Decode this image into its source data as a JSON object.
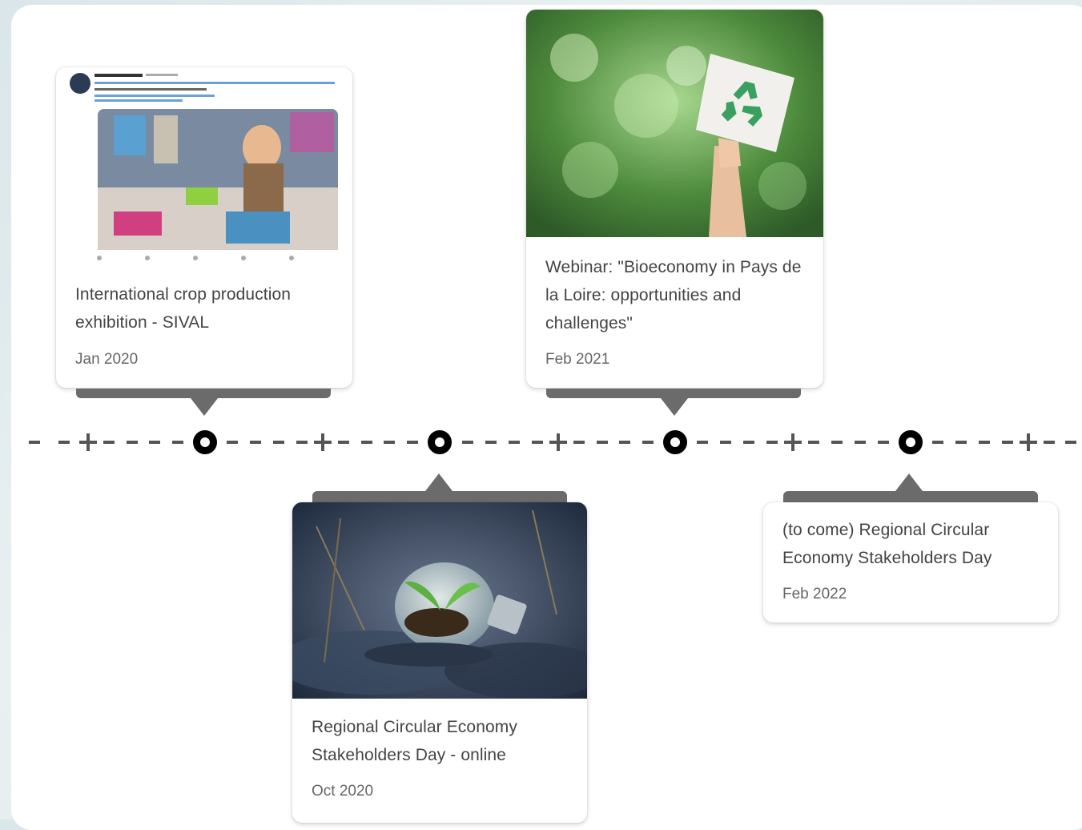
{
  "timeline": {
    "events": [
      {
        "title": "International crop production exhibition - SIVAL",
        "date": "Jan 2020"
      },
      {
        "title": "Regional Circular Economy Stakeholders Day - online",
        "date": "Oct 2020"
      },
      {
        "title": "Webinar: \"Bioeconomy in Pays de la Loire: opportunities and challenges\"",
        "date": "Feb 2021"
      },
      {
        "title": "(to come) Regional Circular Economy Stakeholders Day",
        "date": "Feb 2022"
      }
    ]
  },
  "colors": {
    "connector": "#6b6b6b",
    "axis": "#555555",
    "node": "#000000",
    "card_bg": "#ffffff"
  },
  "icons": {
    "recycle": "recycle-icon",
    "twitter_avatar": "avatar"
  }
}
